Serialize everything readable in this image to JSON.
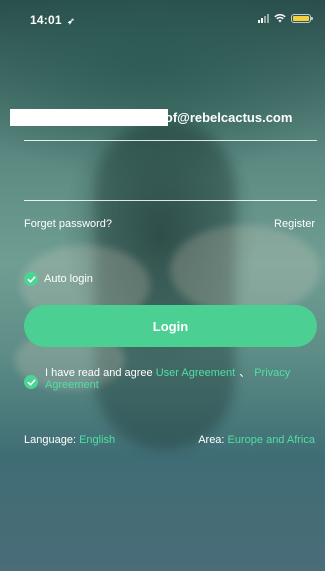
{
  "status_bar": {
    "time": "14:01",
    "location_glyph": "➶",
    "battery_level": 1.0,
    "battery_color": "#f4d03f"
  },
  "login_form": {
    "email_value": "dhof@rebelcactus.com",
    "password_value": "",
    "forget_password_label": "Forget password?",
    "register_label": "Register",
    "auto_login_label": "Auto login",
    "auto_login_checked": true,
    "login_button_label": "Login",
    "agreement": {
      "checked": true,
      "prefix": "I have read and agree ",
      "user_agreement_link": "User Agreement",
      "separator": "、",
      "privacy_agreement_link": "Privacy Agreement"
    },
    "language_label": "Language:",
    "language_value": "English",
    "area_label": "Area:",
    "area_value": "Europe and Africa"
  },
  "colors": {
    "accent_green": "#4ccf92",
    "link_green": "#4fe0a0"
  }
}
